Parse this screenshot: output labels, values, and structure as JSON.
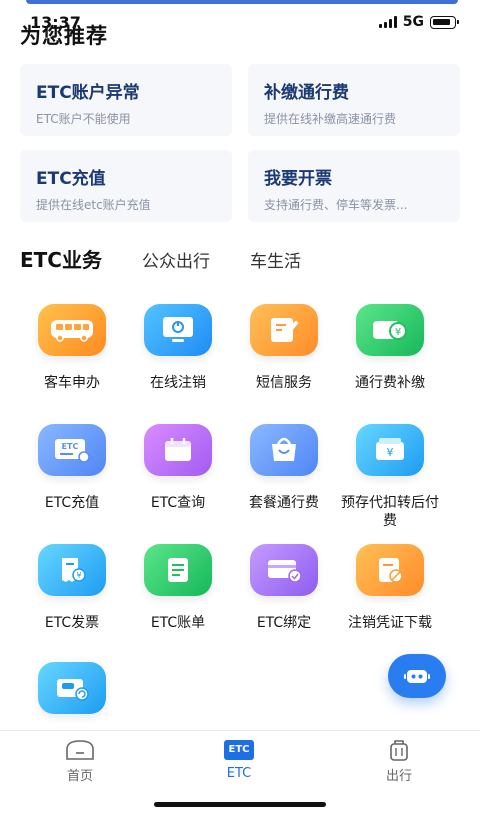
{
  "status_bar": {
    "time": "13:37",
    "network": "5G"
  },
  "recommend": {
    "title": "为您推荐",
    "cards": [
      {
        "title": "ETC账户异常",
        "subtitle": "ETC账户不能使用"
      },
      {
        "title": "补缴通行费",
        "subtitle": "提供在线补缴高速通行费"
      },
      {
        "title": "ETC充值",
        "subtitle": "提供在线etc账户充值"
      },
      {
        "title": "我要开票",
        "subtitle": "支持通行费、停车等发票..."
      }
    ]
  },
  "tabs": [
    {
      "label": "ETC业务",
      "active": true
    },
    {
      "label": "公众出行",
      "active": false
    },
    {
      "label": "车生活",
      "active": false
    }
  ],
  "services": [
    {
      "label": "客车申办",
      "icon": "bus-icon",
      "color": "orange"
    },
    {
      "label": "在线注销",
      "icon": "monitor-power-icon",
      "color": "blue"
    },
    {
      "label": "短信服务",
      "icon": "edit-note-icon",
      "color": "amber"
    },
    {
      "label": "通行费补缴",
      "icon": "car-yuan-icon",
      "color": "green"
    },
    {
      "label": "ETC充值",
      "icon": "etc-card-icon",
      "color": "lightblue"
    },
    {
      "label": "ETC查询",
      "icon": "calendar-icon",
      "color": "purple"
    },
    {
      "label": "套餐通行费",
      "icon": "package-bag-icon",
      "color": "lightblue"
    },
    {
      "label": "预存代扣转后付费",
      "icon": "wallet-yuan-icon",
      "color": "sky"
    },
    {
      "label": "ETC发票",
      "icon": "invoice-yuan-icon",
      "color": "sky"
    },
    {
      "label": "ETC账单",
      "icon": "bill-icon",
      "color": "green"
    },
    {
      "label": "ETC绑定",
      "icon": "card-check-icon",
      "color": "violet"
    },
    {
      "label": "注销凭证下载",
      "icon": "document-cancel-icon",
      "color": "amber"
    },
    {
      "label": "",
      "icon": "car-refresh-icon",
      "color": "sky"
    }
  ],
  "bottom_nav": [
    {
      "label": "首页",
      "icon": "home-icon",
      "active": false
    },
    {
      "label": "ETC",
      "icon": "etc-icon",
      "icon_text": "ETC",
      "active": true
    },
    {
      "label": "出行",
      "icon": "luggage-icon",
      "active": false
    }
  ],
  "colors": {
    "accent": "#1e6fe3",
    "card_title": "#1b3a73",
    "float_button": "#2a7df0"
  }
}
